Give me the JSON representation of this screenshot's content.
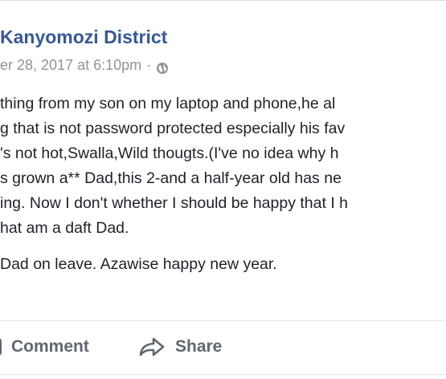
{
  "post": {
    "author_line": "Kanyomozi District",
    "timestamp": "er 28, 2017 at 6:10pm",
    "meta_separator": "·",
    "privacy_icon": "globe-icon",
    "lines": [
      "thing from my son on my laptop and phone,he al",
      "g that is not password protected especially his fav",
      "'s not hot,Swalla,Wild thougts.(I've no idea why h",
      "s grown a** Dad,this 2-and a half-year old has ne",
      "ing. Now I don't whether I should be happy that I h",
      "hat am a daft Dad."
    ],
    "closing_line": " Dad on leave. Azawise happy new year."
  },
  "actions": {
    "comment_label": "Comment",
    "share_label": "Share",
    "comment_icon": "comment-icon",
    "share_icon": "share-icon"
  },
  "colors": {
    "author": "#365899",
    "meta": "#90949c",
    "body": "#1d2129",
    "action": "#606770"
  }
}
